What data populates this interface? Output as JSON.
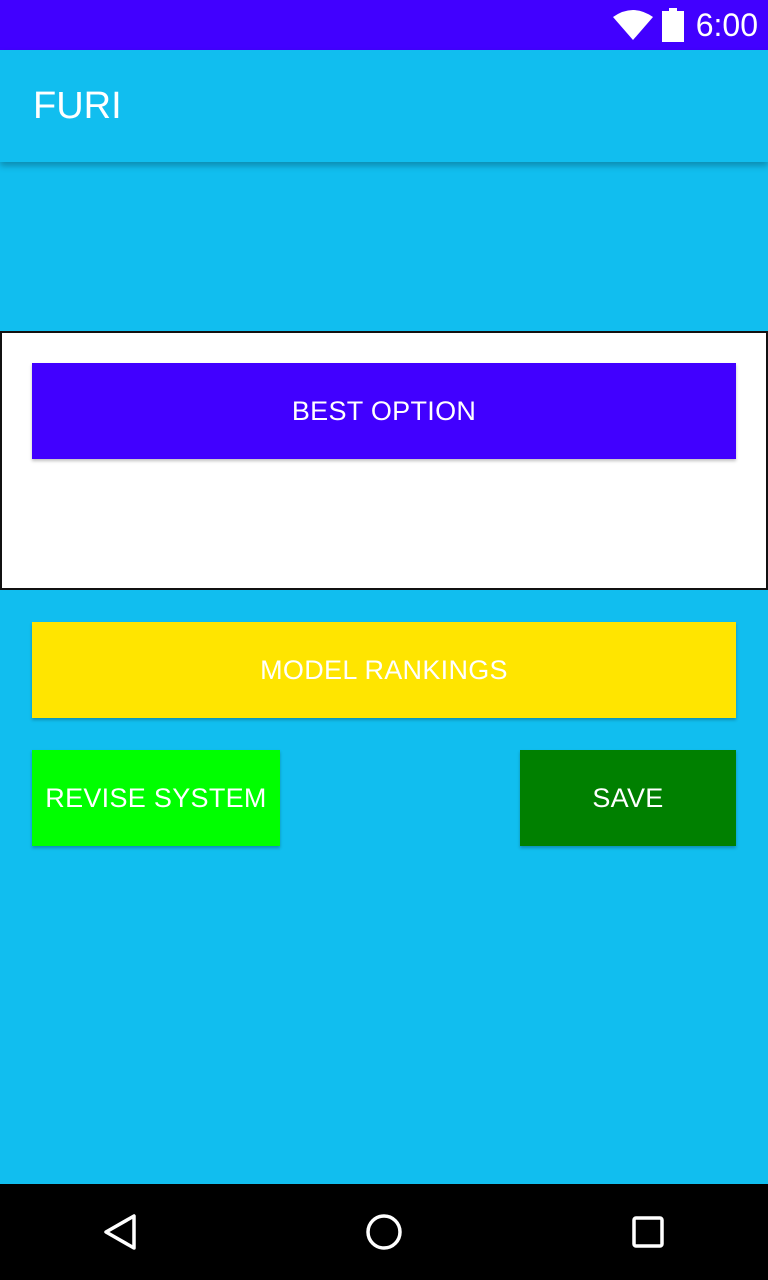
{
  "status_bar": {
    "time": "6:00",
    "background": "#4100FF",
    "icons": [
      "wifi-icon",
      "battery-icon"
    ]
  },
  "app_bar": {
    "title": "FURI",
    "background": "#11BEEF"
  },
  "page": {
    "background": "#11BEEF"
  },
  "panel": {
    "best_option_label": "BEST OPTION",
    "best_option_color": "#4100FF"
  },
  "actions": {
    "model_rankings_label": "MODEL RANKINGS",
    "model_rankings_color": "#FFE500",
    "revise_system_label": "REVISE SYSTEM",
    "revise_system_color": "#00FF00",
    "save_label": "SAVE",
    "save_color": "#008000"
  },
  "nav_bar": {
    "icons": [
      "back-icon",
      "home-icon",
      "recent-apps-icon"
    ]
  }
}
